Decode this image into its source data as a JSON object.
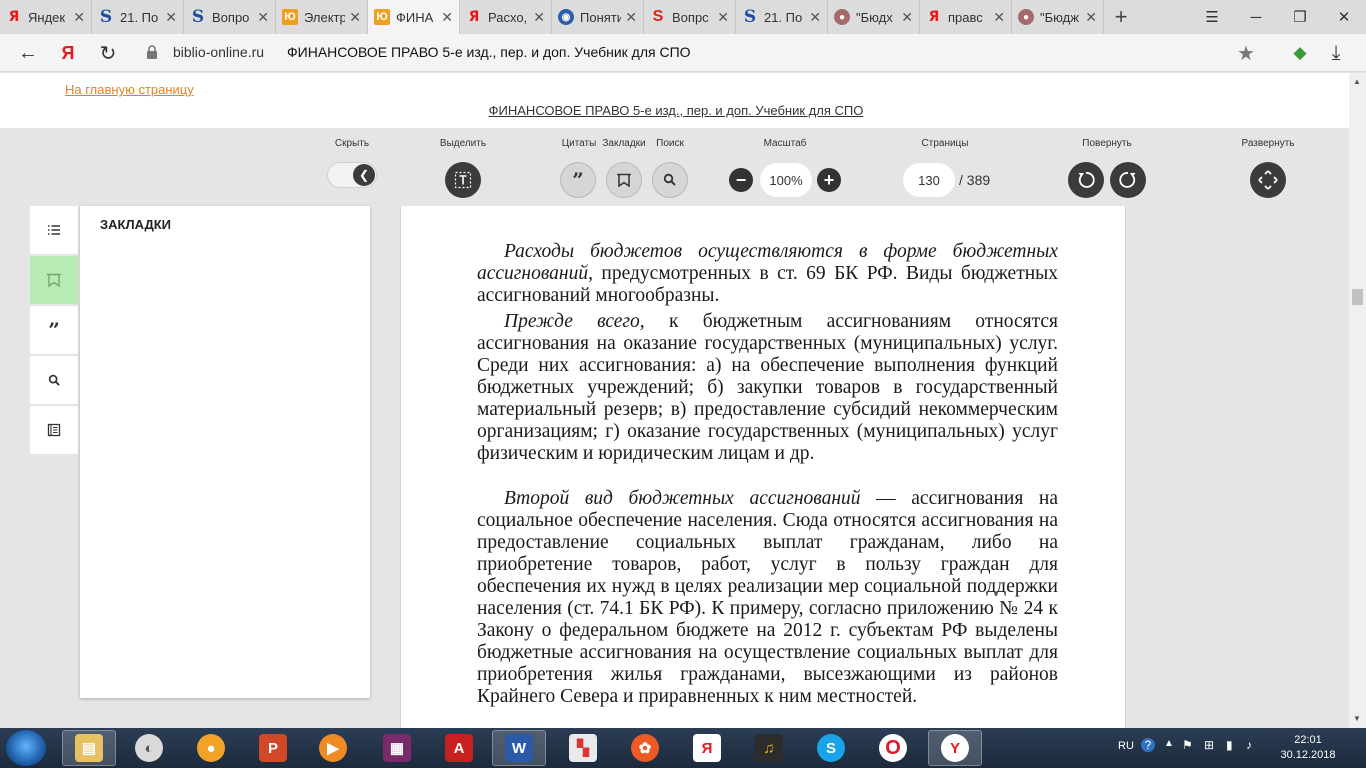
{
  "browser": {
    "tabs": [
      {
        "icon": "yandex-icon",
        "label": "Яндек",
        "active": false
      },
      {
        "icon": "s-letter-icon",
        "label": "21. По",
        "active": false
      },
      {
        "icon": "s-letter-icon",
        "label": "Вопро",
        "active": false
      },
      {
        "icon": "urait-icon",
        "label": "Электр",
        "active": false
      },
      {
        "icon": "urait-icon",
        "label": "ФИНА",
        "active": true
      },
      {
        "icon": "yandex-icon",
        "label": "Расхо,",
        "active": false
      },
      {
        "icon": "globe-icon",
        "label": "Поняти",
        "active": false
      },
      {
        "icon": "s-red-icon",
        "label": "Вопрс",
        "active": false
      },
      {
        "icon": "s-letter-icon",
        "label": "21. По",
        "active": false
      },
      {
        "icon": "avatar-icon",
        "label": "\"Бюдх",
        "active": false
      },
      {
        "icon": "yandex-icon",
        "label": "правс",
        "active": false
      },
      {
        "icon": "avatar-icon",
        "label": "\"Бюдж",
        "active": false
      }
    ],
    "new_tab": "+",
    "address": {
      "domain": "biblio-online.ru",
      "title": "ФИНАНСОВОЕ ПРАВО 5-е изд., пер. и доп. Учебник для СПО"
    }
  },
  "page": {
    "home_link": "На главную страницу",
    "book_title": "ФИНАНСОВОЕ ПРАВО 5-е изд., пер. и доп. Учебник для СПО"
  },
  "toolbar": {
    "hide_label": "Скрыть",
    "select_label": "Выделить",
    "quotes_label": "Цитаты",
    "bookmarks_label": "Закладки",
    "search_label": "Поиск",
    "zoom_label": "Масштаб",
    "zoom_value": "100%",
    "pages_label": "Страницы",
    "current_page": "130",
    "total_pages": "/ 389",
    "rotate_label": "Повернуть",
    "expand_label": "Развернуть"
  },
  "bookmarks_panel": {
    "title": "ЗАКЛАДКИ"
  },
  "book_text": {
    "p1_em": "Расходы бюджетов осуществляются в форме бюджетных ассигнований",
    "p1_rest": ", предусмотренных в ст. 69 БК РФ. Виды бюджетных ассигнований многообразны.",
    "p2_em": "Прежде всего",
    "p2_rest": ", к бюджетным ассигнованиям относятся ассигнования на оказание государственных (муниципальных) услуг. Среди них ассигнования: а) на обеспечение выполнения функций бюджетных учреждений; б) закупки товаров в государственный материальный резерв; в) предоставление субсидий некоммерческим организациям; г) оказание государственных (муниципальных) услуг физическим и юридическим лицам и др.",
    "p3_em": "Второй вид бюджетных ассигнований",
    "p3_rest": " — ассигнования на социальное обеспечение населения. Сюда относятся ассигнования на предоставление социальных выплат гражданам, либо на приобретение товаров, работ, услуг в пользу граждан для обеспечения их нужд в целях реализации мер социальной поддержки населения (ст. 74.1 БК РФ). К примеру, согласно приложению № 24 к Закону о федеральном бюджете на 2012 г. субъектам РФ выделены бюджетные ассигнования на осуществление социальных выплат для приобретения жилья гражданами, высезжающими из районов Крайнего Севера и приравненных к ним местностей."
  },
  "taskbar": {
    "language": "RU",
    "time": "22:01",
    "date": "30.12.2018"
  }
}
